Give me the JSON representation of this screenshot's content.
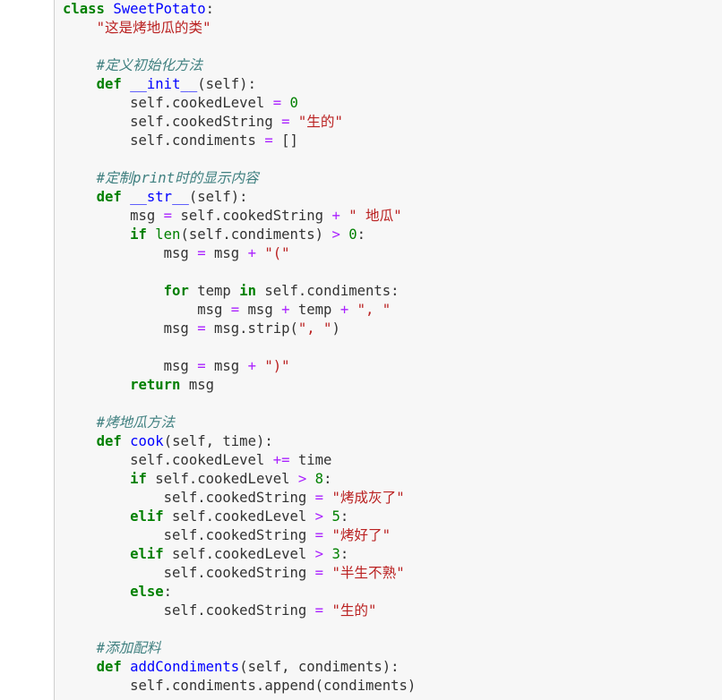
{
  "editor": {
    "lines": [
      [
        {
          "t": "class",
          "c": "kw"
        },
        {
          "t": " ",
          "c": "txt"
        },
        {
          "t": "SweetPotato",
          "c": "def"
        },
        {
          "t": ":",
          "c": "txt"
        }
      ],
      [
        {
          "t": "    ",
          "c": "txt"
        },
        {
          "t": "\"这是烤地瓜的类\"",
          "c": "str"
        }
      ],
      [],
      [
        {
          "t": "    ",
          "c": "txt"
        },
        {
          "t": "#定义初始化方法",
          "c": "com"
        }
      ],
      [
        {
          "t": "    ",
          "c": "txt"
        },
        {
          "t": "def",
          "c": "kw"
        },
        {
          "t": " ",
          "c": "txt"
        },
        {
          "t": "__init__",
          "c": "def"
        },
        {
          "t": "(self):",
          "c": "txt"
        }
      ],
      [
        {
          "t": "        self.cookedLevel ",
          "c": "txt"
        },
        {
          "t": "=",
          "c": "op"
        },
        {
          "t": " ",
          "c": "txt"
        },
        {
          "t": "0",
          "c": "num"
        }
      ],
      [
        {
          "t": "        self.cookedString ",
          "c": "txt"
        },
        {
          "t": "=",
          "c": "op"
        },
        {
          "t": " ",
          "c": "txt"
        },
        {
          "t": "\"生的\"",
          "c": "str"
        }
      ],
      [
        {
          "t": "        self.condiments ",
          "c": "txt"
        },
        {
          "t": "=",
          "c": "op"
        },
        {
          "t": " []",
          "c": "txt"
        }
      ],
      [],
      [
        {
          "t": "    ",
          "c": "txt"
        },
        {
          "t": "#定制print时的显示内容",
          "c": "com"
        }
      ],
      [
        {
          "t": "    ",
          "c": "txt"
        },
        {
          "t": "def",
          "c": "kw"
        },
        {
          "t": " ",
          "c": "txt"
        },
        {
          "t": "__str__",
          "c": "def"
        },
        {
          "t": "(self):",
          "c": "txt"
        }
      ],
      [
        {
          "t": "        msg ",
          "c": "txt"
        },
        {
          "t": "=",
          "c": "op"
        },
        {
          "t": " self.cookedString ",
          "c": "txt"
        },
        {
          "t": "+",
          "c": "op"
        },
        {
          "t": " ",
          "c": "txt"
        },
        {
          "t": "\" 地瓜\"",
          "c": "str"
        }
      ],
      [
        {
          "t": "        ",
          "c": "txt"
        },
        {
          "t": "if",
          "c": "kw"
        },
        {
          "t": " ",
          "c": "txt"
        },
        {
          "t": "len",
          "c": "bi"
        },
        {
          "t": "(self.condiments) ",
          "c": "txt"
        },
        {
          "t": ">",
          "c": "op"
        },
        {
          "t": " ",
          "c": "txt"
        },
        {
          "t": "0",
          "c": "num"
        },
        {
          "t": ":",
          "c": "txt"
        }
      ],
      [
        {
          "t": "            msg ",
          "c": "txt"
        },
        {
          "t": "=",
          "c": "op"
        },
        {
          "t": " msg ",
          "c": "txt"
        },
        {
          "t": "+",
          "c": "op"
        },
        {
          "t": " ",
          "c": "txt"
        },
        {
          "t": "\"(\"",
          "c": "str"
        }
      ],
      [],
      [
        {
          "t": "            ",
          "c": "txt"
        },
        {
          "t": "for",
          "c": "kw"
        },
        {
          "t": " temp ",
          "c": "txt"
        },
        {
          "t": "in",
          "c": "kw"
        },
        {
          "t": " self.condiments:",
          "c": "txt"
        }
      ],
      [
        {
          "t": "                msg ",
          "c": "txt"
        },
        {
          "t": "=",
          "c": "op"
        },
        {
          "t": " msg ",
          "c": "txt"
        },
        {
          "t": "+",
          "c": "op"
        },
        {
          "t": " temp ",
          "c": "txt"
        },
        {
          "t": "+",
          "c": "op"
        },
        {
          "t": " ",
          "c": "txt"
        },
        {
          "t": "\", \"",
          "c": "str"
        }
      ],
      [
        {
          "t": "            msg ",
          "c": "txt"
        },
        {
          "t": "=",
          "c": "op"
        },
        {
          "t": " msg.strip(",
          "c": "txt"
        },
        {
          "t": "\", \"",
          "c": "str"
        },
        {
          "t": ")",
          "c": "txt"
        }
      ],
      [],
      [
        {
          "t": "            msg ",
          "c": "txt"
        },
        {
          "t": "=",
          "c": "op"
        },
        {
          "t": " msg ",
          "c": "txt"
        },
        {
          "t": "+",
          "c": "op"
        },
        {
          "t": " ",
          "c": "txt"
        },
        {
          "t": "\")\"",
          "c": "str"
        }
      ],
      [
        {
          "t": "        ",
          "c": "txt"
        },
        {
          "t": "return",
          "c": "kw"
        },
        {
          "t": " msg",
          "c": "txt"
        }
      ],
      [],
      [
        {
          "t": "    ",
          "c": "txt"
        },
        {
          "t": "#烤地瓜方法",
          "c": "com"
        }
      ],
      [
        {
          "t": "    ",
          "c": "txt"
        },
        {
          "t": "def",
          "c": "kw"
        },
        {
          "t": " ",
          "c": "txt"
        },
        {
          "t": "cook",
          "c": "def"
        },
        {
          "t": "(self, time):",
          "c": "txt"
        }
      ],
      [
        {
          "t": "        self.cookedLevel ",
          "c": "txt"
        },
        {
          "t": "+=",
          "c": "op"
        },
        {
          "t": " time",
          "c": "txt"
        }
      ],
      [
        {
          "t": "        ",
          "c": "txt"
        },
        {
          "t": "if",
          "c": "kw"
        },
        {
          "t": " self.cookedLevel ",
          "c": "txt"
        },
        {
          "t": ">",
          "c": "op"
        },
        {
          "t": " ",
          "c": "txt"
        },
        {
          "t": "8",
          "c": "num"
        },
        {
          "t": ":",
          "c": "txt"
        }
      ],
      [
        {
          "t": "            self.cookedString ",
          "c": "txt"
        },
        {
          "t": "=",
          "c": "op"
        },
        {
          "t": " ",
          "c": "txt"
        },
        {
          "t": "\"烤成灰了\"",
          "c": "str"
        }
      ],
      [
        {
          "t": "        ",
          "c": "txt"
        },
        {
          "t": "elif",
          "c": "kw"
        },
        {
          "t": " self.cookedLevel ",
          "c": "txt"
        },
        {
          "t": ">",
          "c": "op"
        },
        {
          "t": " ",
          "c": "txt"
        },
        {
          "t": "5",
          "c": "num"
        },
        {
          "t": ":",
          "c": "txt"
        }
      ],
      [
        {
          "t": "            self.cookedString ",
          "c": "txt"
        },
        {
          "t": "=",
          "c": "op"
        },
        {
          "t": " ",
          "c": "txt"
        },
        {
          "t": "\"烤好了\"",
          "c": "str"
        }
      ],
      [
        {
          "t": "        ",
          "c": "txt"
        },
        {
          "t": "elif",
          "c": "kw"
        },
        {
          "t": " self.cookedLevel ",
          "c": "txt"
        },
        {
          "t": ">",
          "c": "op"
        },
        {
          "t": " ",
          "c": "txt"
        },
        {
          "t": "3",
          "c": "num"
        },
        {
          "t": ":",
          "c": "txt"
        }
      ],
      [
        {
          "t": "            self.cookedString ",
          "c": "txt"
        },
        {
          "t": "=",
          "c": "op"
        },
        {
          "t": " ",
          "c": "txt"
        },
        {
          "t": "\"半生不熟\"",
          "c": "str"
        }
      ],
      [
        {
          "t": "        ",
          "c": "txt"
        },
        {
          "t": "else",
          "c": "kw"
        },
        {
          "t": ":",
          "c": "txt"
        }
      ],
      [
        {
          "t": "            self.cookedString ",
          "c": "txt"
        },
        {
          "t": "=",
          "c": "op"
        },
        {
          "t": " ",
          "c": "txt"
        },
        {
          "t": "\"生的\"",
          "c": "str"
        }
      ],
      [],
      [
        {
          "t": "    ",
          "c": "txt"
        },
        {
          "t": "#添加配料",
          "c": "com"
        }
      ],
      [
        {
          "t": "    ",
          "c": "txt"
        },
        {
          "t": "def",
          "c": "kw"
        },
        {
          "t": " ",
          "c": "txt"
        },
        {
          "t": "addCondiments",
          "c": "def"
        },
        {
          "t": "(self, condiments):",
          "c": "txt"
        }
      ],
      [
        {
          "t": "        self.condiments.append(condiments)",
          "c": "txt"
        }
      ]
    ]
  }
}
